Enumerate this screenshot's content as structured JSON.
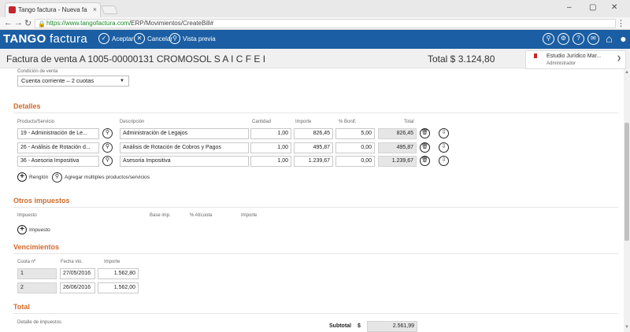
{
  "browser": {
    "tab_title": "Tango factura - Nueva fa",
    "tab_close": "×",
    "url_host": "https://www.tangofactura.com",
    "url_path": "/ERP/Movimientos/CreateBill#",
    "min": "–",
    "max": "▢",
    "close": "✕"
  },
  "app": {
    "logo_bold": "TANGO",
    "logo_light": " factura",
    "toolbar": {
      "accept": "Aceptar",
      "cancel": "Cancelar",
      "preview": "Vista previa"
    }
  },
  "header": {
    "title": "Factura de venta A 1005-00000131 CROMOSOL S A I C F E I",
    "total": "Total $ 3.124,80"
  },
  "user": {
    "name": "Estudio Jurídico Mar...",
    "role": "Administrador"
  },
  "condicion": {
    "label": "Condición de venta",
    "value": "Cuenta corriente – 2 cuotas"
  },
  "detalles": {
    "title": "Detalles",
    "headers": {
      "producto": "Producto/Servicio",
      "descripcion": "Descripción",
      "cantidad": "Cantidad",
      "importe": "Importe",
      "bonif": "% Bonif.",
      "total": "Total"
    },
    "rows": [
      {
        "producto": "19 - Administración de Le...",
        "descripcion": "Administración de Legajos",
        "cantidad": "1,00",
        "importe": "826,45",
        "bonif": "5,00",
        "total": "826,45"
      },
      {
        "producto": "26 - Análisis de Rotación d...",
        "descripcion": "Análisis de Rotación de Cobros y Pagos",
        "cantidad": "1,00",
        "importe": "495,87",
        "bonif": "0,00",
        "total": "495,87"
      },
      {
        "producto": "36 - Asesoria Impositiva",
        "descripcion": "Asesoria Impositiva",
        "cantidad": "1,00",
        "importe": "1.239,67",
        "bonif": "0,00",
        "total": "1.239,67"
      }
    ],
    "add_row": "Renglón",
    "add_multiple": "Agregar múltiples productos/servicios"
  },
  "otros": {
    "title": "Otros impuestos",
    "headers": {
      "impuesto": "Impuesto",
      "base": "Base imp.",
      "alicuota": "% Alícuota",
      "importe": "Importe"
    },
    "add": "Impuesto"
  },
  "vencimientos": {
    "title": "Vencimientos",
    "headers": {
      "cuota": "Cuota nº",
      "fecha": "Fecha vto.",
      "importe": "Importe"
    },
    "rows": [
      {
        "cuota": "1",
        "fecha": "27/05/2016",
        "importe": "1.562,80"
      },
      {
        "cuota": "2",
        "fecha": "26/06/2016",
        "importe": "1.562,00"
      }
    ]
  },
  "total": {
    "title": "Total",
    "detalle_label": "Detalle de impuestos",
    "subtotal_label": "Subtotal",
    "currency": "$",
    "subtotal_value": "2.561,99"
  }
}
